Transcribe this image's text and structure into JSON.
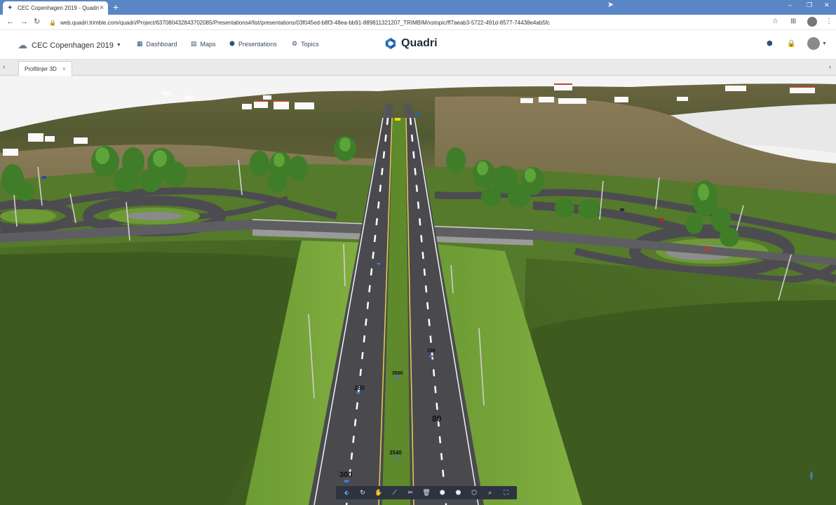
{
  "browser": {
    "tab_title": "CEC Copenhagen 2019 - Quadri",
    "new_tab": "+",
    "url": "web.quadri.trimble.com/quadri/Project/637080432843702085/Presentations#/list/presentations/03f045ed-b8f3-48ea-bb91-889811321207_TRIMBIM/xstopic/ff7aeab3-5722-491d-8577-74438e4ab5fc",
    "close": "×"
  },
  "header": {
    "project_name": "CEC Copenhagen 2019",
    "brand": "Quadri",
    "nav": [
      {
        "label": "Dashboard",
        "icon": "grid-icon"
      },
      {
        "label": "Maps",
        "icon": "map-icon"
      },
      {
        "label": "Presentations",
        "icon": "cube-icon"
      },
      {
        "label": "Topics",
        "icon": "topic-icon"
      }
    ]
  },
  "doc_tabs": [
    {
      "label": "Profilinjer 3D"
    }
  ],
  "viewport": {
    "road_labels": [
      {
        "text": "300"
      },
      {
        "text": "280"
      },
      {
        "text": "80"
      },
      {
        "text": "3540"
      },
      {
        "text": "3560"
      },
      {
        "text": "100"
      }
    ]
  },
  "toolbar": {
    "tools": [
      {
        "name": "select-tool",
        "icon": "tag-icon",
        "glyph": "⬖"
      },
      {
        "name": "rotate-tool",
        "icon": "rotate-icon",
        "glyph": "↻"
      },
      {
        "name": "pan-tool",
        "icon": "hand-icon",
        "glyph": "✋"
      },
      {
        "name": "measure-tool",
        "icon": "ruler-icon",
        "glyph": "⟋"
      },
      {
        "name": "clip-tool",
        "icon": "scissors-icon",
        "glyph": "✂"
      },
      {
        "name": "delete-tool",
        "icon": "trash-icon",
        "glyph": "🗑"
      },
      {
        "name": "box-tool",
        "icon": "cube-icon",
        "glyph": "⬢"
      },
      {
        "name": "section-tool",
        "icon": "cube-section-icon",
        "glyph": "⬣"
      },
      {
        "name": "layers-tool",
        "icon": "cube-layers-icon",
        "glyph": "⬡"
      },
      {
        "name": "zoom-tool",
        "icon": "zoom-icon",
        "glyph": "⌕"
      },
      {
        "name": "fullscreen-tool",
        "icon": "fullscreen-icon",
        "glyph": "⛶"
      }
    ]
  },
  "colors": {
    "tabstrip": "#5a86c5",
    "brand_blue": "#1b5aa8",
    "toolbar_bg": "#2d3440",
    "grass": "#5d8a2e",
    "asphalt": "#4a4a4e"
  }
}
